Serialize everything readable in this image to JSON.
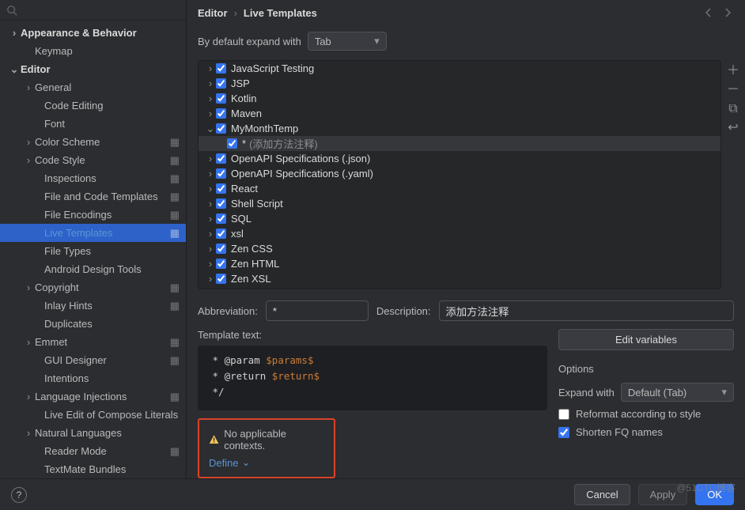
{
  "breadcrumb": {
    "parent": "Editor",
    "current": "Live Templates"
  },
  "search": {
    "hint": ""
  },
  "sidebar": {
    "items": [
      {
        "label": "Appearance & Behavior",
        "level": 0,
        "arrow": "right",
        "gear": false
      },
      {
        "label": "Keymap",
        "level": 1,
        "arrow": "",
        "gear": false
      },
      {
        "label": "Editor",
        "level": 0,
        "arrow": "down",
        "gear": false
      },
      {
        "label": "General",
        "level": 1,
        "arrow": "right",
        "gear": false
      },
      {
        "label": "Code Editing",
        "level": 2,
        "arrow": "",
        "gear": false
      },
      {
        "label": "Font",
        "level": 2,
        "arrow": "",
        "gear": false
      },
      {
        "label": "Color Scheme",
        "level": 1,
        "arrow": "right",
        "gear": true
      },
      {
        "label": "Code Style",
        "level": 1,
        "arrow": "right",
        "gear": true
      },
      {
        "label": "Inspections",
        "level": 2,
        "arrow": "",
        "gear": true
      },
      {
        "label": "File and Code Templates",
        "level": 2,
        "arrow": "",
        "gear": true
      },
      {
        "label": "File Encodings",
        "level": 2,
        "arrow": "",
        "gear": true
      },
      {
        "label": "Live Templates",
        "level": 2,
        "arrow": "",
        "gear": true,
        "selected": true,
        "modified": true
      },
      {
        "label": "File Types",
        "level": 2,
        "arrow": "",
        "gear": false
      },
      {
        "label": "Android Design Tools",
        "level": 2,
        "arrow": "",
        "gear": false
      },
      {
        "label": "Copyright",
        "level": 1,
        "arrow": "right",
        "gear": true
      },
      {
        "label": "Inlay Hints",
        "level": 2,
        "arrow": "",
        "gear": true
      },
      {
        "label": "Duplicates",
        "level": 2,
        "arrow": "",
        "gear": false
      },
      {
        "label": "Emmet",
        "level": 1,
        "arrow": "right",
        "gear": true
      },
      {
        "label": "GUI Designer",
        "level": 2,
        "arrow": "",
        "gear": true
      },
      {
        "label": "Intentions",
        "level": 2,
        "arrow": "",
        "gear": false
      },
      {
        "label": "Language Injections",
        "level": 1,
        "arrow": "right",
        "gear": true
      },
      {
        "label": "Live Edit of Compose Literals",
        "level": 2,
        "arrow": "",
        "gear": false
      },
      {
        "label": "Natural Languages",
        "level": 1,
        "arrow": "right",
        "gear": false
      },
      {
        "label": "Reader Mode",
        "level": 2,
        "arrow": "",
        "gear": true
      },
      {
        "label": "TextMate Bundles",
        "level": 2,
        "arrow": "",
        "gear": false
      }
    ]
  },
  "expand": {
    "label": "By default expand with",
    "value": "Tab"
  },
  "templates": [
    {
      "label": "JavaScript Testing",
      "arrow": "right",
      "checked": true
    },
    {
      "label": "JSP",
      "arrow": "right",
      "checked": true
    },
    {
      "label": "Kotlin",
      "arrow": "right",
      "checked": true
    },
    {
      "label": "Maven",
      "arrow": "right",
      "checked": true
    },
    {
      "label": "MyMonthTemp",
      "arrow": "down",
      "checked": true
    },
    {
      "label": "*",
      "desc": "(添加方法注释)",
      "arrow": "",
      "checked": true,
      "child": true,
      "selected": true
    },
    {
      "label": "OpenAPI Specifications (.json)",
      "arrow": "right",
      "checked": true
    },
    {
      "label": "OpenAPI Specifications (.yaml)",
      "arrow": "right",
      "checked": true
    },
    {
      "label": "React",
      "arrow": "right",
      "checked": true
    },
    {
      "label": "Shell Script",
      "arrow": "right",
      "checked": true
    },
    {
      "label": "SQL",
      "arrow": "right",
      "checked": true
    },
    {
      "label": "xsl",
      "arrow": "right",
      "checked": true
    },
    {
      "label": "Zen CSS",
      "arrow": "right",
      "checked": true
    },
    {
      "label": "Zen HTML",
      "arrow": "right",
      "checked": true
    },
    {
      "label": "Zen XSL",
      "arrow": "right",
      "checked": true
    }
  ],
  "details": {
    "abbrev_label": "Abbreviation:",
    "abbrev_value": "*",
    "desc_label": "Description:",
    "desc_value": "添加方法注释",
    "template_text_label": "Template text:",
    "template_code": {
      "l1a": " * @param ",
      "l1v": "$params$",
      "l2a": " * @return ",
      "l2v": "$return$",
      "l3": " */"
    },
    "context_warning": "No applicable contexts.",
    "define_label": "Define",
    "edit_vars": "Edit variables",
    "options_title": "Options",
    "expand_with_label": "Expand with",
    "expand_with_value": "Default (Tab)",
    "reformat_label": "Reformat according to style",
    "reformat_checked": false,
    "shorten_label": "Shorten FQ names",
    "shorten_checked": true
  },
  "footer": {
    "cancel": "Cancel",
    "apply": "Apply",
    "ok": "OK"
  },
  "watermark": "@51CTO博客"
}
